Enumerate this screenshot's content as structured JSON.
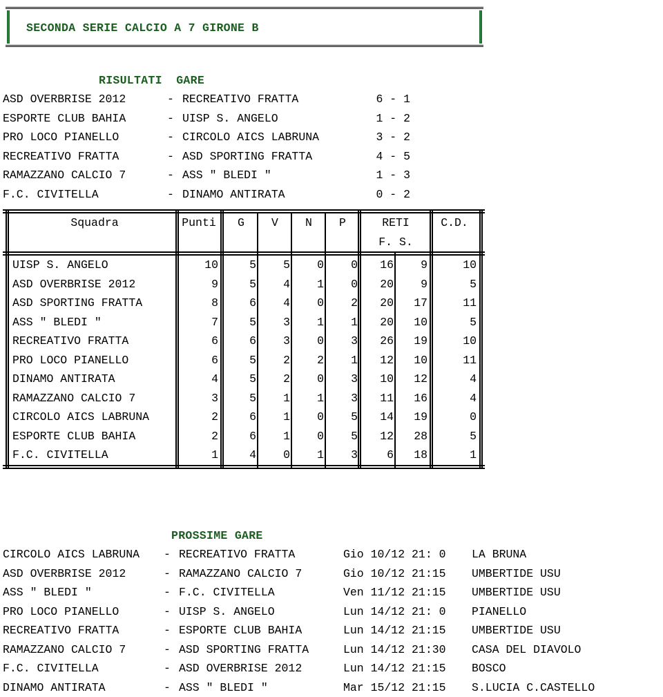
{
  "title": {
    "text": "SECONDA SERIE CALCIO A 7 GIRONE B",
    "accent_color": "#1b5e20",
    "border_color": "#000000"
  },
  "results_section": {
    "heading": "RISULTATI  GARE",
    "matches": [
      {
        "home": "ASD OVERBRISE 2012",
        "dash": "-",
        "away": "RECREATIVO FRATTA",
        "score": "6 - 1"
      },
      {
        "home": "ESPORTE CLUB BAHIA",
        "dash": "-",
        "away": "UISP S. ANGELO",
        "score": "1 - 2"
      },
      {
        "home": "PRO LOCO PIANELLO",
        "dash": "-",
        "away": "CIRCOLO AICS LABRUNA",
        "score": "3 - 2"
      },
      {
        "home": "RECREATIVO FRATTA",
        "dash": "-",
        "away": "ASD SPORTING FRATTA",
        "score": "4 - 5"
      },
      {
        "home": "RAMAZZANO CALCIO 7",
        "dash": "-",
        "away": "ASS \" BLEDI \"",
        "score": "1 - 3"
      },
      {
        "home": "F.C. CIVITELLA",
        "dash": "-",
        "away": "DINAMO ANTIRATA",
        "score": "0 - 2"
      }
    ]
  },
  "standings": {
    "headers": {
      "team": "Squadra",
      "punti": "Punti",
      "g": "G",
      "v": "V",
      "n": "N",
      "p": "P",
      "reti": "RETI",
      "reti_sub": "F. S.",
      "cd": "C.D."
    },
    "rows": [
      {
        "team": "UISP S. ANGELO",
        "punti": "10",
        "g": "5",
        "v": "5",
        "n": "0",
        "p": "0",
        "f": "16",
        "s": "9",
        "cd": "10"
      },
      {
        "team": "ASD OVERBRISE 2012",
        "punti": "9",
        "g": "5",
        "v": "4",
        "n": "1",
        "p": "0",
        "f": "20",
        "s": "9",
        "cd": "5"
      },
      {
        "team": "ASD SPORTING FRATTA",
        "punti": "8",
        "g": "6",
        "v": "4",
        "n": "0",
        "p": "2",
        "f": "20",
        "s": "17",
        "cd": "11"
      },
      {
        "team": "ASS \" BLEDI \"",
        "punti": "7",
        "g": "5",
        "v": "3",
        "n": "1",
        "p": "1",
        "f": "20",
        "s": "10",
        "cd": "5"
      },
      {
        "team": "RECREATIVO FRATTA",
        "punti": "6",
        "g": "6",
        "v": "3",
        "n": "0",
        "p": "3",
        "f": "26",
        "s": "19",
        "cd": "10"
      },
      {
        "team": "PRO LOCO PIANELLO",
        "punti": "6",
        "g": "5",
        "v": "2",
        "n": "2",
        "p": "1",
        "f": "12",
        "s": "10",
        "cd": "11"
      },
      {
        "team": "DINAMO ANTIRATA",
        "punti": "4",
        "g": "5",
        "v": "2",
        "n": "0",
        "p": "3",
        "f": "10",
        "s": "12",
        "cd": "4"
      },
      {
        "team": "RAMAZZANO CALCIO 7",
        "punti": "3",
        "g": "5",
        "v": "1",
        "n": "1",
        "p": "3",
        "f": "11",
        "s": "16",
        "cd": "4"
      },
      {
        "team": "CIRCOLO AICS LABRUNA",
        "punti": "2",
        "g": "6",
        "v": "1",
        "n": "0",
        "p": "5",
        "f": "14",
        "s": "19",
        "cd": "0"
      },
      {
        "team": "ESPORTE CLUB BAHIA",
        "punti": "2",
        "g": "6",
        "v": "1",
        "n": "0",
        "p": "5",
        "f": "12",
        "s": "28",
        "cd": "5"
      },
      {
        "team": "F.C. CIVITELLA",
        "punti": "1",
        "g": "4",
        "v": "0",
        "n": "1",
        "p": "3",
        "f": "6",
        "s": "18",
        "cd": "1"
      }
    ]
  },
  "upcoming_section": {
    "heading": "PROSSIME GARE",
    "matches": [
      {
        "home": "CIRCOLO AICS LABRUNA",
        "dash": "-",
        "away": "RECREATIVO FRATTA",
        "when": "Gio 10/12 21: 0",
        "venue": "LA BRUNA"
      },
      {
        "home": "ASD OVERBRISE 2012",
        "dash": "-",
        "away": "RAMAZZANO CALCIO 7",
        "when": "Gio 10/12 21:15",
        "venue": "UMBERTIDE USU"
      },
      {
        "home": "ASS \" BLEDI \"",
        "dash": "-",
        "away": "F.C. CIVITELLA",
        "when": "Ven 11/12 21:15",
        "venue": "UMBERTIDE USU"
      },
      {
        "home": "PRO LOCO PIANELLO",
        "dash": "-",
        "away": "UISP S. ANGELO",
        "when": "Lun 14/12 21: 0",
        "venue": "PIANELLO"
      },
      {
        "home": "RECREATIVO FRATTA",
        "dash": "-",
        "away": "ESPORTE CLUB BAHIA",
        "when": "Lun 14/12 21:15",
        "venue": "UMBERTIDE USU"
      },
      {
        "home": "RAMAZZANO CALCIO 7",
        "dash": "-",
        "away": "ASD SPORTING FRATTA",
        "when": "Lun 14/12 21:30",
        "venue": "CASA DEL DIAVOLO"
      },
      {
        "home": "F.C. CIVITELLA",
        "dash": "-",
        "away": "ASD OVERBRISE 2012",
        "when": "Lun 14/12 21:15",
        "venue": "BOSCO"
      },
      {
        "home": "DINAMO ANTIRATA",
        "dash": "-",
        "away": "ASS \" BLEDI \"",
        "when": "Mar 15/12 21:15",
        "venue": "S.LUCIA C.CASTELLO"
      }
    ]
  }
}
